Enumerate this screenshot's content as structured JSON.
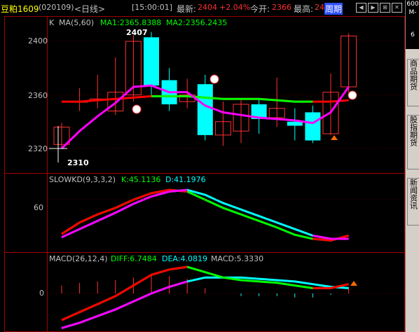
{
  "header": {
    "symbol": "豆粕1609",
    "code": "(020109)",
    "period": "<日线>",
    "time": "[15:00:01]",
    "latest_label": "最新:",
    "latest_value": "2404",
    "change": "+2.04%",
    "open_label": "今开:",
    "open_value": "2366",
    "high_label": "最高:",
    "high_value": "24",
    "tab_week": "周期"
  },
  "right_top": {
    "l1": "600",
    "l2": "M-",
    "l3": "6"
  },
  "right_tabs": [
    "商品期货",
    "股指期货",
    "新闻资讯"
  ],
  "main_panel": {
    "legend_k": "K",
    "legend_ma": "MA(5,60)",
    "ma1": "MA1:2365.8388",
    "ma2": "MA2:2356.2435",
    "y_labels": [
      "2400",
      "2360",
      "2320"
    ],
    "high_mark": "2407",
    "low_mark": "2310",
    "ma1_color": "#ff00ff",
    "ma2_color": "#ff0000"
  },
  "kd_panel": {
    "title": "SLOWKD(9,3,3,2)",
    "k": "K:45.1136",
    "d": "D:41.1976",
    "y_label": "60"
  },
  "macd_panel": {
    "title": "MACD(26,12,4)",
    "diff": "DIFF:6.7484",
    "dea": "DEA:4.0819",
    "macd": "MACD:5.3330",
    "y_label": "0"
  },
  "chart_data": {
    "type": "line",
    "candles": [
      {
        "o": 2323,
        "c": 2336,
        "h": 2339,
        "l": 2321
      },
      {
        "o": 2355,
        "c": 2355,
        "h": 2365,
        "l": 2348
      },
      {
        "o": 2356,
        "c": 2357,
        "h": 2375,
        "l": 2350
      },
      {
        "o": 2348,
        "c": 2362,
        "h": 2388,
        "l": 2345
      },
      {
        "o": 2360,
        "c": 2400,
        "h": 2405,
        "l": 2355
      },
      {
        "o": 2403,
        "c": 2367,
        "h": 2407,
        "l": 2360
      },
      {
        "o": 2371,
        "c": 2353,
        "h": 2380,
        "l": 2348
      },
      {
        "o": 2355,
        "c": 2360,
        "h": 2372,
        "l": 2350
      },
      {
        "o": 2368,
        "c": 2330,
        "h": 2375,
        "l": 2326
      },
      {
        "o": 2330,
        "c": 2340,
        "h": 2355,
        "l": 2322
      },
      {
        "o": 2333,
        "c": 2353,
        "h": 2356,
        "l": 2324
      },
      {
        "o": 2353,
        "c": 2342,
        "h": 2357,
        "l": 2331
      },
      {
        "o": 2343,
        "c": 2350,
        "h": 2373,
        "l": 2336
      },
      {
        "o": 2340,
        "c": 2337,
        "h": 2350,
        "l": 2326
      },
      {
        "o": 2347,
        "c": 2326,
        "h": 2352,
        "l": 2324
      },
      {
        "o": 2331,
        "c": 2362,
        "h": 2376,
        "l": 2330
      },
      {
        "o": 2366,
        "c": 2404,
        "h": 2406,
        "l": 2362
      }
    ],
    "ma1": [
      2320,
      2333,
      2344,
      2354,
      2366,
      2367,
      2362,
      2362,
      2352,
      2347,
      2345,
      2343,
      2342,
      2341,
      2339,
      2347,
      2366
    ],
    "ma2": [
      2355,
      2355,
      2356,
      2357,
      2358,
      2359,
      2359,
      2359,
      2358,
      2357,
      2357,
      2357,
      2356,
      2355,
      2355,
      2355,
      2356
    ],
    "kd_k": [
      18,
      32,
      42,
      50,
      60,
      68,
      72,
      70,
      60,
      50,
      42,
      34,
      26,
      17,
      12,
      10,
      16
    ],
    "kd_d": [
      14,
      24,
      34,
      44,
      55,
      64,
      70,
      72,
      66,
      56,
      48,
      40,
      32,
      24,
      16,
      12,
      12
    ],
    "macd_diff": [
      -20,
      -14,
      -8,
      -2,
      6,
      14,
      18,
      20,
      16,
      12,
      10,
      9,
      8,
      6,
      4,
      4,
      7
    ],
    "macd_dea": [
      -26,
      -22,
      -17,
      -12,
      -6,
      0,
      5,
      9,
      12,
      12,
      12,
      11,
      10,
      9,
      7,
      5,
      4
    ],
    "macd_hist": [
      6,
      8,
      9,
      10,
      12,
      14,
      13,
      11,
      4,
      0,
      -2,
      -2,
      -2,
      -3,
      -3,
      -1,
      5
    ]
  }
}
